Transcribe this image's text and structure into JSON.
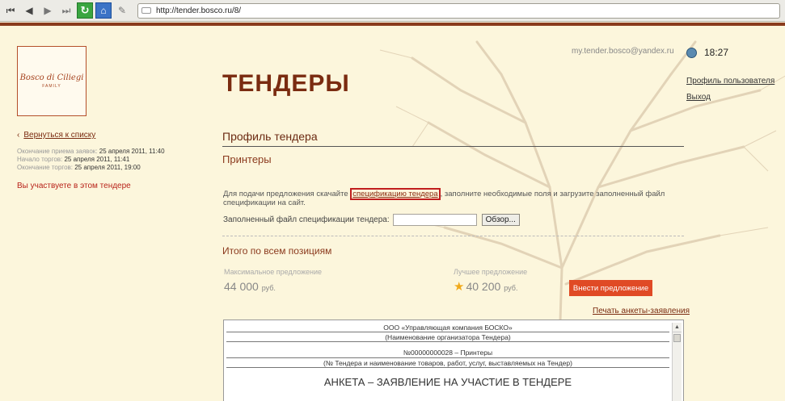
{
  "browser": {
    "url": "http://tender.bosco.ru/8/"
  },
  "logo": {
    "brand": "Bosco di Ciliegi",
    "sub": "FAMILY"
  },
  "sidebar": {
    "back_label": "Вернуться к списку",
    "dates": [
      {
        "label": "Окончание приема заявок:",
        "value": "25 апреля 2011, 11:40"
      },
      {
        "label": "Начало торгов:",
        "value": "25 апреля 2011, 11:41"
      },
      {
        "label": "Окончание торгов:",
        "value": "25 апреля 2011, 19:00"
      }
    ],
    "participate": "Вы участвуете в этом тендере"
  },
  "header": {
    "email": "my.tender.bosco@yandex.ru",
    "time": "18:27",
    "title": "ТЕНДЕРЫ",
    "profile_link": "Профиль пользователя",
    "logout_link": "Выход"
  },
  "main": {
    "section_title": "Профиль тендера",
    "tender_name": "Принтеры",
    "intro_before": "Для подачи предложения скачайте ",
    "intro_link": "спецификацию тендера",
    "intro_after": ", заполните необходимые поля и загрузите заполненный файл спецификации на сайт.",
    "file_label": "Заполненный файл спецификации тендера:",
    "browse_label": "Обзор...",
    "totals_title": "Итого по всем позициям",
    "max_label": "Максимальное предложение",
    "max_value": "44 000",
    "max_unit": "руб.",
    "best_label": "Лучшее предложение",
    "best_value": "40 200",
    "best_unit": "руб.",
    "submit_label": "Внести предложение",
    "print_link": "Печать анкеты-заявления"
  },
  "document": {
    "lines": [
      "ООО «Управляющая компания БОСКО»",
      "(Наименование организатора Тендера)",
      "№00000000028 – Принтеры",
      "(№ Тендера и наименование товаров, работ, услуг, выставляемых на Тендер)"
    ],
    "heading": "АНКЕТА – ЗАЯВЛЕНИЕ НА УЧАСТИЕ В ТЕНДЕРЕ"
  }
}
